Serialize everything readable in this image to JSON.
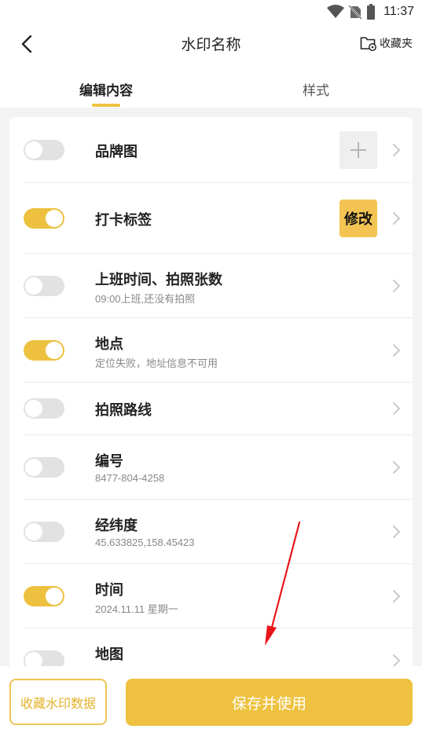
{
  "status_bar": {
    "time": "11:37",
    "icons": [
      "wifi-icon",
      "no-sim-icon",
      "battery-icon"
    ]
  },
  "nav": {
    "title": "水印名称",
    "back_icon": "chevron-left-icon",
    "favorites_label": "收藏夹",
    "favorites_icon": "folder-settings-icon"
  },
  "tabs": [
    {
      "label": "编辑内容",
      "active": true
    },
    {
      "label": "样式",
      "active": false
    }
  ],
  "items": [
    {
      "title": "品牌图",
      "subtitle": "",
      "enabled": false,
      "accessory": "plus"
    },
    {
      "title": "打卡标签",
      "subtitle": "",
      "enabled": true,
      "accessory": "修改"
    },
    {
      "title": "上班时间、拍照张数",
      "subtitle": "09:00上班,还没有拍照",
      "enabled": false
    },
    {
      "title": "地点",
      "subtitle": "定位失败，地址信息不可用",
      "enabled": true
    },
    {
      "title": "拍照路线",
      "subtitle": "",
      "enabled": false
    },
    {
      "title": "编号",
      "subtitle": "8477-804-4258",
      "enabled": false
    },
    {
      "title": "经纬度",
      "subtitle": "45.633825,158.45423",
      "enabled": false
    },
    {
      "title": "时间",
      "subtitle": "2024.11.11 星期一",
      "enabled": true
    },
    {
      "title": "地图",
      "subtitle": "",
      "enabled": false
    }
  ],
  "bottom": {
    "save_data_label": "收藏水印数据",
    "save_use_label": "保存并使用"
  },
  "colors": {
    "accent": "#eec240",
    "badge": "#f3c453",
    "toggle_off": "#e2e2e2",
    "annotation_arrow": "#e8161b"
  }
}
